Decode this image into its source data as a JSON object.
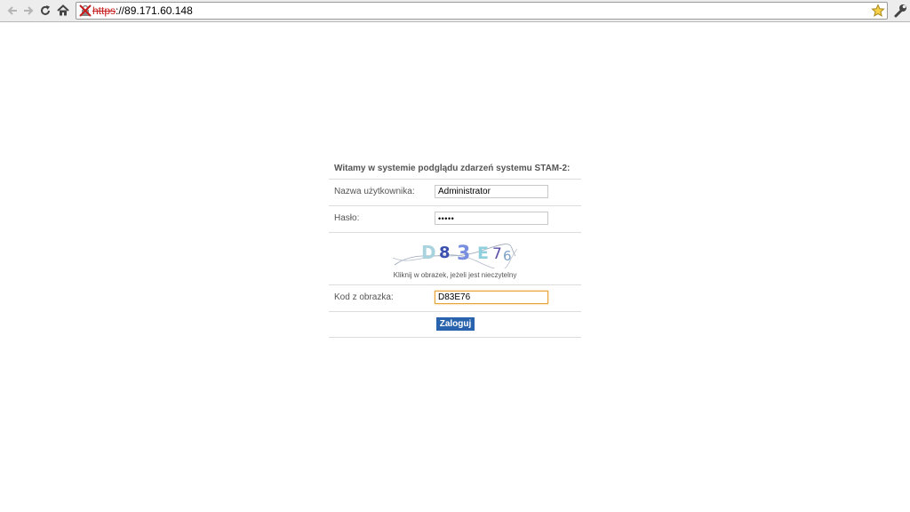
{
  "browser": {
    "url_scheme": "https",
    "url_separator": "://",
    "url_host": "89.171.60.148",
    "icons": {
      "back": "arrow-left-icon",
      "forward": "arrow-right-icon",
      "reload": "reload-icon",
      "home": "home-icon",
      "security": "insecure-lock-icon",
      "bookmark": "star-icon",
      "menu": "wrench-icon"
    }
  },
  "login": {
    "welcome": "Witamy w systemie podglądu zdarzeń systemu STAM-2:",
    "username_label": "Nazwa użytkownika:",
    "username_value": "Administrator",
    "password_label": "Hasło:",
    "password_value": "•••••",
    "captcha_text": "D83E76",
    "captcha_chars": [
      "D",
      "8",
      "3",
      "E",
      "7",
      "6"
    ],
    "captcha_hint": "Kliknij w obrazek, jeżeli jest nieczytelny",
    "code_label": "Kod z obrazka:",
    "code_value": "D83E76",
    "submit_label": "Zaloguj"
  },
  "colors": {
    "button": "#2a63ad",
    "focus_border": "#e8a33a",
    "insecure_red": "#c81c1c"
  }
}
